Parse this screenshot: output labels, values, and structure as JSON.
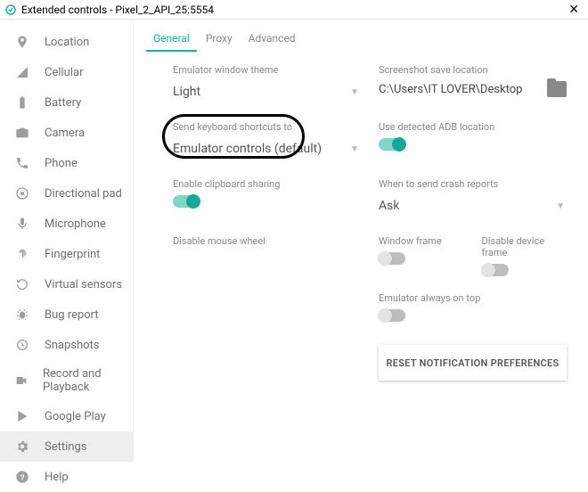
{
  "window": {
    "title": "Extended controls - Pixel_2_API_25:5554"
  },
  "sidebar": {
    "items": [
      {
        "label": "Location"
      },
      {
        "label": "Cellular"
      },
      {
        "label": "Battery"
      },
      {
        "label": "Camera"
      },
      {
        "label": "Phone"
      },
      {
        "label": "Directional pad"
      },
      {
        "label": "Microphone"
      },
      {
        "label": "Fingerprint"
      },
      {
        "label": "Virtual sensors"
      },
      {
        "label": "Bug report"
      },
      {
        "label": "Snapshots"
      },
      {
        "label": "Record and Playback"
      },
      {
        "label": "Google Play"
      },
      {
        "label": "Settings"
      },
      {
        "label": "Help"
      }
    ]
  },
  "tabs": {
    "general": "General",
    "proxy": "Proxy",
    "advanced": "Advanced"
  },
  "settings": {
    "theme_label": "Emulator window theme",
    "theme_value": "Light",
    "screenshot_label": "Screenshot save location",
    "screenshot_value": "C:\\Users\\IT LOVER\\Desktop",
    "shortcuts_label": "Send keyboard shortcuts to",
    "shortcuts_value": "Emulator controls (default)",
    "adb_label": "Use detected ADB location",
    "clipboard_label": "Enable clipboard sharing",
    "crash_label": "When to send crash reports",
    "crash_value": "Ask",
    "mouse_label": "Disable mouse wheel",
    "frame_label": "Window frame",
    "disable_device_frame_label": "Disable device frame",
    "always_top_label": "Emulator always on top",
    "reset_label": "RESET NOTIFICATION PREFERENCES"
  }
}
